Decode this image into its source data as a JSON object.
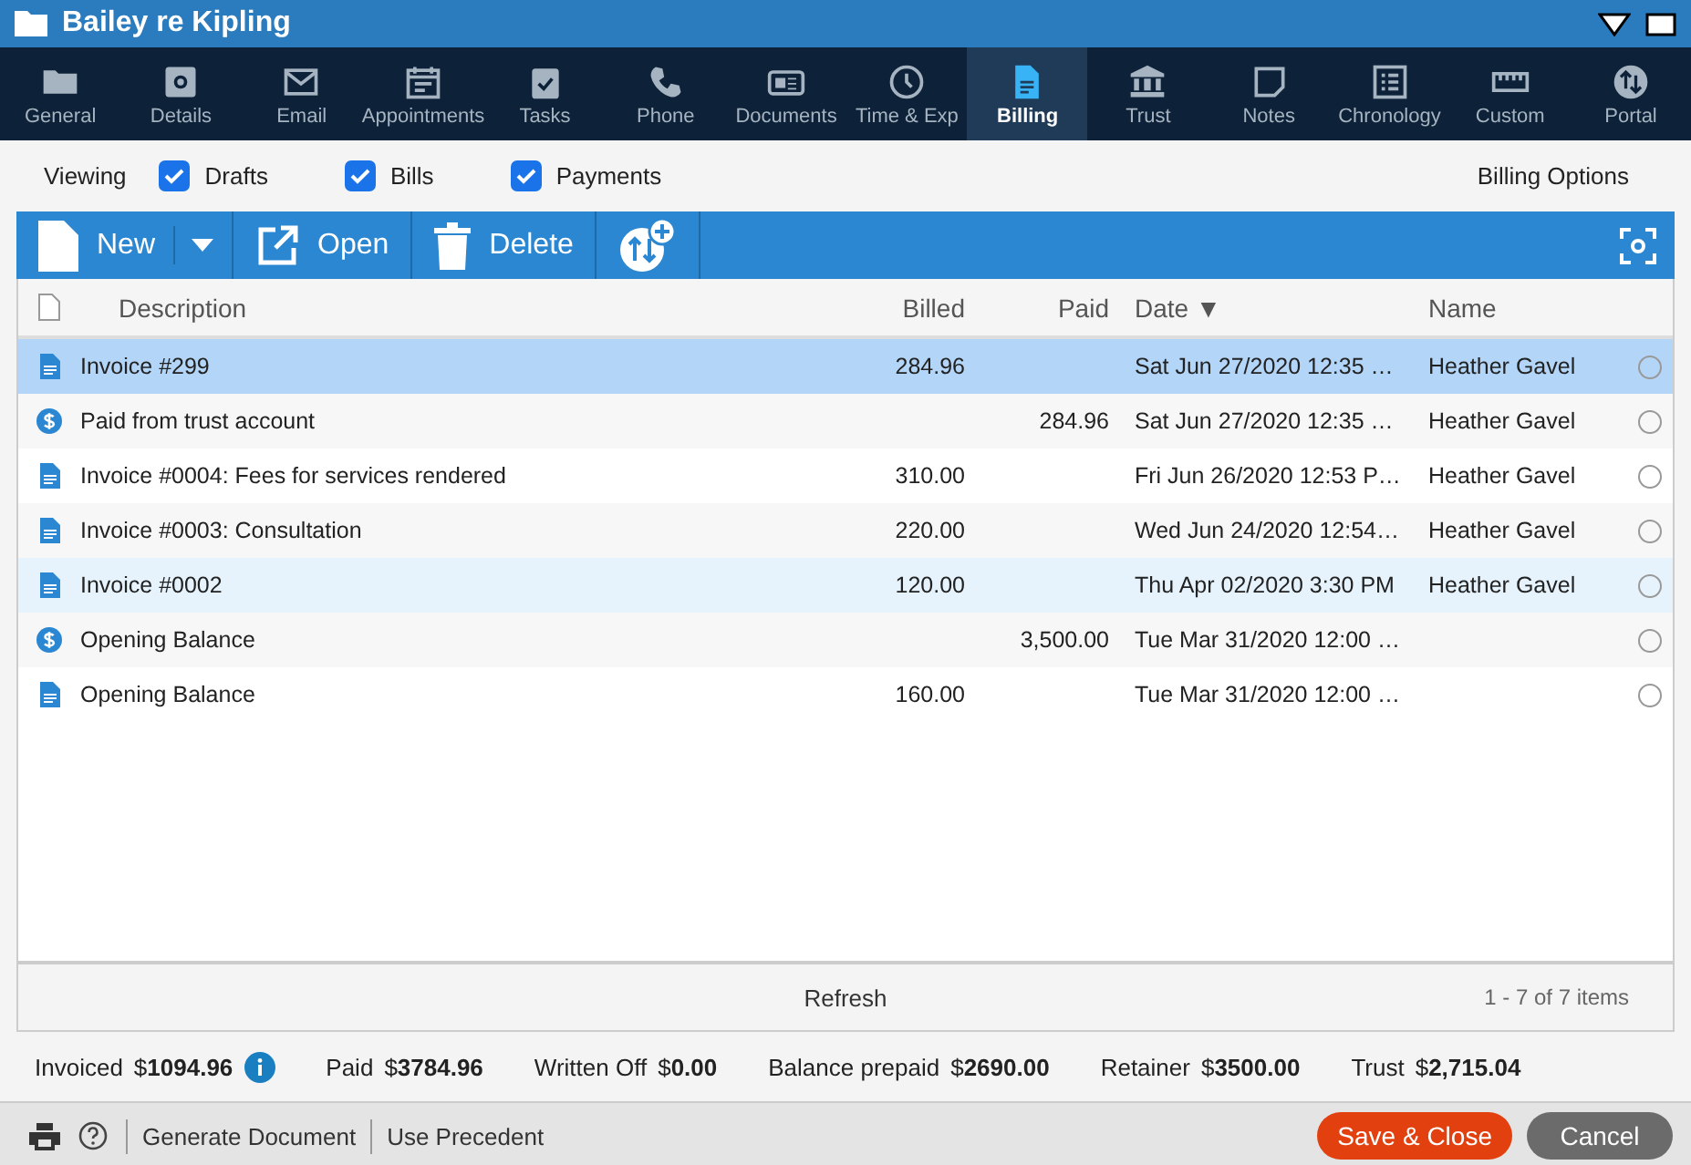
{
  "window": {
    "title": "Bailey re Kipling"
  },
  "tabs": [
    {
      "label": "General",
      "selected": false
    },
    {
      "label": "Details",
      "selected": false
    },
    {
      "label": "Email",
      "selected": false
    },
    {
      "label": "Appointments",
      "selected": false
    },
    {
      "label": "Tasks",
      "selected": false
    },
    {
      "label": "Phone",
      "selected": false
    },
    {
      "label": "Documents",
      "selected": false
    },
    {
      "label": "Time & Exp",
      "selected": false
    },
    {
      "label": "Billing",
      "selected": true
    },
    {
      "label": "Trust",
      "selected": false
    },
    {
      "label": "Notes",
      "selected": false
    },
    {
      "label": "Chronology",
      "selected": false
    },
    {
      "label": "Custom",
      "selected": false
    },
    {
      "label": "Portal",
      "selected": false
    }
  ],
  "filter_bar": {
    "label": "Viewing",
    "filters": [
      {
        "label": "Drafts",
        "checked": true
      },
      {
        "label": "Bills",
        "checked": true
      },
      {
        "label": "Payments",
        "checked": true
      }
    ],
    "options_link": "Billing Options"
  },
  "toolbar": {
    "new": "New",
    "open": "Open",
    "delete": "Delete"
  },
  "table": {
    "columns": [
      "Description",
      "Billed",
      "Paid",
      "Date ▼",
      "Name"
    ],
    "rows": [
      {
        "kind": "invoice",
        "description": "Invoice #299",
        "billed": "284.96",
        "paid": "",
        "date": "Sat Jun 27/2020 12:35 …",
        "name": "Heather Gavel",
        "selected": true,
        "hovered": false
      },
      {
        "kind": "payment",
        "description": "Paid from trust account",
        "billed": "",
        "paid": "284.96",
        "date": "Sat Jun 27/2020 12:35 …",
        "name": "Heather Gavel",
        "selected": false,
        "hovered": false
      },
      {
        "kind": "invoice",
        "description": "Invoice #0004: Fees for services rendered",
        "billed": "310.00",
        "paid": "",
        "date": "Fri Jun 26/2020 12:53 P…",
        "name": "Heather Gavel",
        "selected": false,
        "hovered": false
      },
      {
        "kind": "invoice",
        "description": "Invoice #0003: Consultation",
        "billed": "220.00",
        "paid": "",
        "date": "Wed Jun 24/2020 12:54…",
        "name": "Heather Gavel",
        "selected": false,
        "hovered": false
      },
      {
        "kind": "invoice",
        "description": "Invoice #0002",
        "billed": "120.00",
        "paid": "",
        "date": "Thu Apr 02/2020 3:30 PM",
        "name": "Heather Gavel",
        "selected": false,
        "hovered": true
      },
      {
        "kind": "payment",
        "description": "Opening Balance",
        "billed": "",
        "paid": "3,500.00",
        "date": "Tue Mar 31/2020 12:00 …",
        "name": "",
        "selected": false,
        "hovered": false
      },
      {
        "kind": "invoice",
        "description": "Opening Balance",
        "billed": "160.00",
        "paid": "",
        "date": "Tue Mar 31/2020 12:00 …",
        "name": "",
        "selected": false,
        "hovered": false
      }
    ],
    "refresh": "Refresh",
    "pager": "1 - 7 of 7 items"
  },
  "summary": [
    {
      "label": "Invoiced",
      "value": "$**1094.96**",
      "info": true
    },
    {
      "label": "Paid",
      "value": "$**3784.96**",
      "info": false
    },
    {
      "label": "Written Off",
      "value": "$**0.00**",
      "info": false
    },
    {
      "label": "Balance prepaid",
      "value": "$**2690.00**",
      "info": false
    },
    {
      "label": "Retainer",
      "value": "$**3500.00**",
      "info": false
    },
    {
      "label": "Trust",
      "value": "$**2,715.04**",
      "info": false
    }
  ],
  "footer": {
    "links": [
      "Generate Document",
      "Use Precedent"
    ],
    "save": "Save & Close",
    "cancel": "Cancel"
  }
}
